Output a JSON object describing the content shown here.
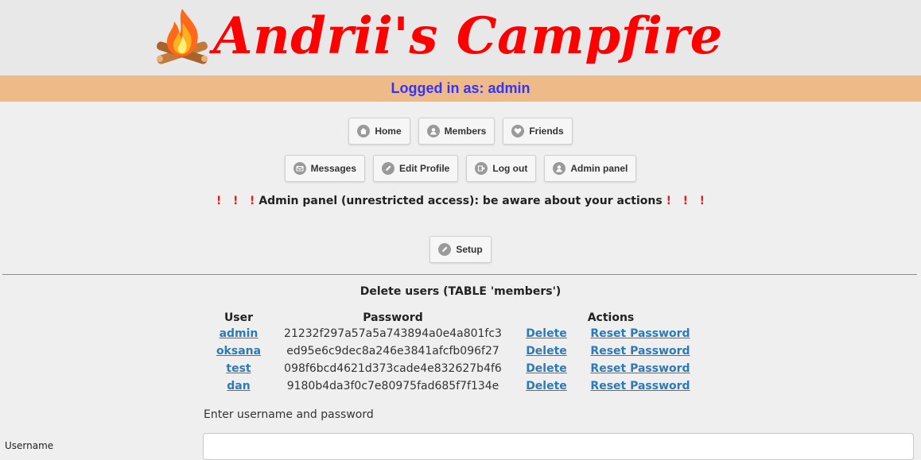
{
  "header": {
    "site_title": "Andrii's Campfire",
    "logo_icon": "campfire-icon"
  },
  "status": {
    "text": "Logged in as: admin",
    "color": "#3333ff",
    "background": "#eebb88"
  },
  "nav": {
    "row1": [
      {
        "label": "Home",
        "icon": "home-icon"
      },
      {
        "label": "Members",
        "icon": "user-icon"
      },
      {
        "label": "Friends",
        "icon": "heart-icon"
      }
    ],
    "row2": [
      {
        "label": "Messages",
        "icon": "mail-icon"
      },
      {
        "label": "Edit Profile",
        "icon": "edit-icon"
      },
      {
        "label": "Log out",
        "icon": "logout-icon"
      },
      {
        "label": "Admin panel",
        "icon": "user-icon"
      }
    ],
    "setup": {
      "label": "Setup",
      "icon": "edit-icon"
    }
  },
  "warning": {
    "marks": "!",
    "text": "Admin panel (unrestricted access): be aware about your actions"
  },
  "members_section": {
    "title": "Delete users (TABLE 'members')",
    "columns": {
      "user": "User",
      "password": "Password",
      "actions": "Actions"
    },
    "rows": [
      {
        "user": "admin",
        "password": "21232f297a57a5a743894a0e4a801fc3",
        "delete": "Delete",
        "reset": "Reset Password"
      },
      {
        "user": "oksana",
        "password": "ed95e6c9dec8a246e3841afcfb096f27",
        "delete": "Delete",
        "reset": "Reset Password"
      },
      {
        "user": "test",
        "password": "098f6bcd4621d373cade4e832627b4f6",
        "delete": "Delete",
        "reset": "Reset Password"
      },
      {
        "user": "dan",
        "password": "9180b4da3f0c7e80975fad685f7f134e",
        "delete": "Delete",
        "reset": "Reset Password"
      }
    ]
  },
  "form": {
    "prompt": "Enter username and password",
    "username_label": "Username",
    "username_value": ""
  },
  "colors": {
    "title_red": "#ff0000",
    "link_blue": "#2b7bb9",
    "warning_red": "#e51c1c"
  }
}
